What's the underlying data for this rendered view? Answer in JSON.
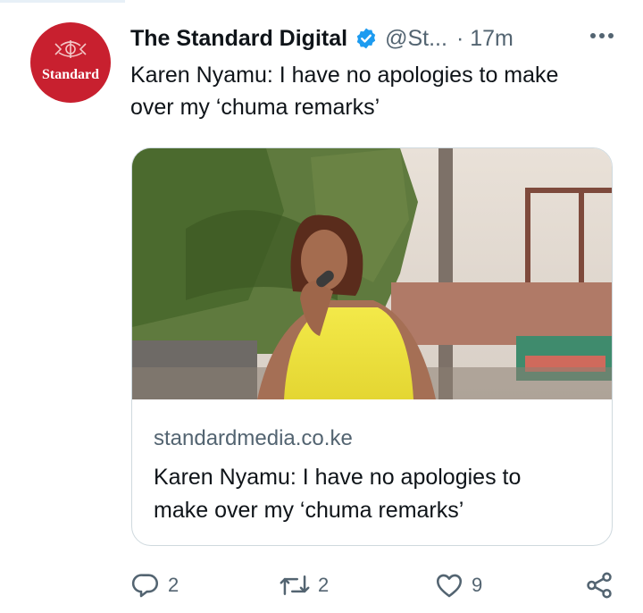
{
  "account": {
    "name": "The Standard Digital",
    "handle": "@St...",
    "separator": "·",
    "time": "17m",
    "avatar_text": "Standard",
    "avatar_color": "#c8202f"
  },
  "tweet": {
    "line1": "Karen Nyamu: I have no apologies to make",
    "line2": "over my ‘chuma remarks’"
  },
  "card": {
    "domain": "standardmedia.co.ke",
    "title_line1": "Karen Nyamu: I have no apologies to",
    "title_line2": "make over my ‘chuma remarks’"
  },
  "actions": {
    "reply_count": "2",
    "retweet_count": "2",
    "like_count": "9"
  },
  "icons": [
    "verified-icon",
    "more-icon",
    "reply-icon",
    "retweet-icon",
    "like-icon",
    "share-icon"
  ],
  "colors": {
    "verified": "#1d9bf0",
    "muted": "#536471",
    "text": "#0f1419"
  }
}
